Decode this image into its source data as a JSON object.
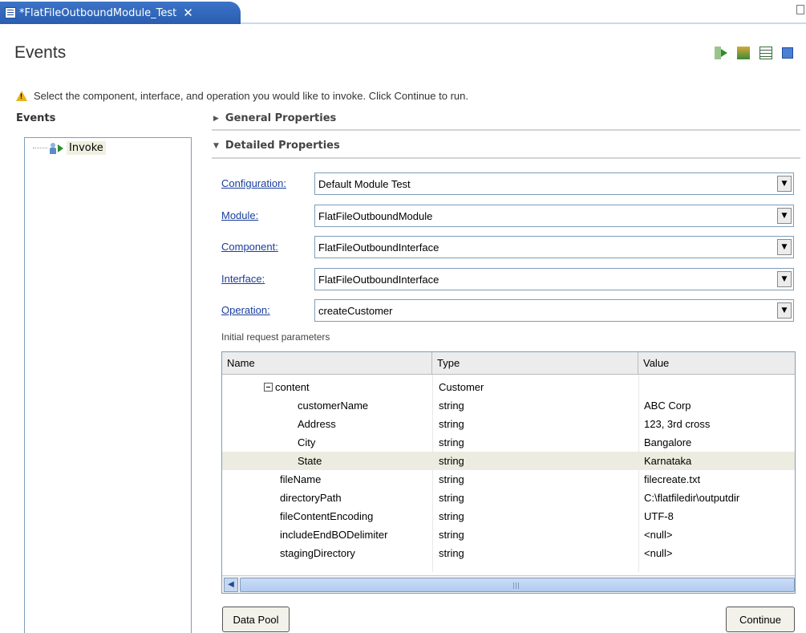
{
  "tab": {
    "title": "*FlatFileOutboundModule_Test"
  },
  "page": {
    "title": "Events"
  },
  "hint": "Select the component, interface, and operation you would like to invoke. Click Continue to run.",
  "events": {
    "label": "Events",
    "items": [
      {
        "label": "Invoke"
      }
    ]
  },
  "sections": {
    "general": "General Properties",
    "detailed": "Detailed Properties"
  },
  "form": {
    "configuration": {
      "label": "Configuration:",
      "value": "Default Module Test"
    },
    "module": {
      "label": "Module:",
      "value": "FlatFileOutboundModule"
    },
    "component": {
      "label": "Component:",
      "value": "FlatFileOutboundInterface"
    },
    "interface": {
      "label": "Interface:",
      "value": "FlatFileOutboundInterface"
    },
    "operation": {
      "label": "Operation:",
      "value": "createCustomer"
    }
  },
  "params": {
    "caption": "Initial request parameters",
    "columns": [
      "Name",
      "Type",
      "Value"
    ],
    "rows": [
      {
        "name": "content",
        "type": "Customer",
        "value": ""
      },
      {
        "name": "customerName",
        "type": "string",
        "value": "ABC Corp"
      },
      {
        "name": "Address",
        "type": "string",
        "value": "123, 3rd cross"
      },
      {
        "name": "City",
        "type": "string",
        "value": "Bangalore"
      },
      {
        "name": "State",
        "type": "string",
        "value": "Karnataka"
      },
      {
        "name": "fileName",
        "type": "string",
        "value": "filecreate.txt"
      },
      {
        "name": "directoryPath",
        "type": "string",
        "value": "C:\\flatfiledir\\outputdir"
      },
      {
        "name": "fileContentEncoding",
        "type": "string",
        "value": "UTF-8"
      },
      {
        "name": "includeEndBODelimiter",
        "type": "string",
        "value": "<null>"
      },
      {
        "name": "stagingDirectory",
        "type": "string",
        "value": "<null>"
      }
    ]
  },
  "buttons": {
    "data_pool": "Data Pool",
    "continue": "Continue"
  },
  "colors": {
    "accent": "#2a5db0",
    "link": "#1a3e9c",
    "selection": "#ecece0"
  },
  "icons": [
    "run-test-icon",
    "add-test-icon",
    "table-icon",
    "stop-icon",
    "warning-icon",
    "close-icon"
  ]
}
